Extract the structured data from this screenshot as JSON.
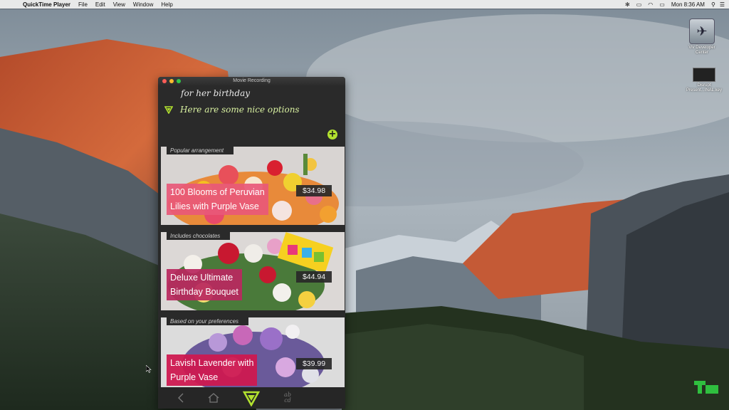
{
  "menubar": {
    "app_name": "QuickTime Player",
    "items": [
      "File",
      "Edit",
      "View",
      "Window",
      "Help"
    ],
    "clock": "Mon 8:36 AM"
  },
  "desktop_icons": [
    {
      "label_line1": "Viv Developer",
      "label_line2": "Center"
    },
    {
      "label_line1": "Disrupt",
      "label_line2": "Present...INAL.key"
    }
  ],
  "window": {
    "title": "Movie Recording"
  },
  "app": {
    "query_text": "for her birthday",
    "response_text": "Here are some nice options",
    "cards": [
      {
        "tag": "Popular arrangement",
        "name_line1": "100 Blooms of Peruvian",
        "name_line2": "Lilies with Purple Vase",
        "price": "$34.98"
      },
      {
        "tag": "Includes chocolates",
        "name_line1": "Deluxe Ultimate",
        "name_line2": "Birthday Bouquet",
        "price": "$44.94"
      },
      {
        "tag": "Based on your preferences",
        "name_line1": "Lavish Lavender with",
        "name_line2": "Purple Vase",
        "price": "$39.99"
      }
    ],
    "nav": {
      "abc_line1": "ab",
      "abc_line2": "cd"
    },
    "accent_color": "#b2e12f"
  },
  "icons": [
    "apple-icon",
    "wifi-icon",
    "battery-icon",
    "spotlight-icon",
    "viv-logo-icon",
    "add-icon",
    "back-icon",
    "home-icon",
    "keyboard-icon"
  ]
}
